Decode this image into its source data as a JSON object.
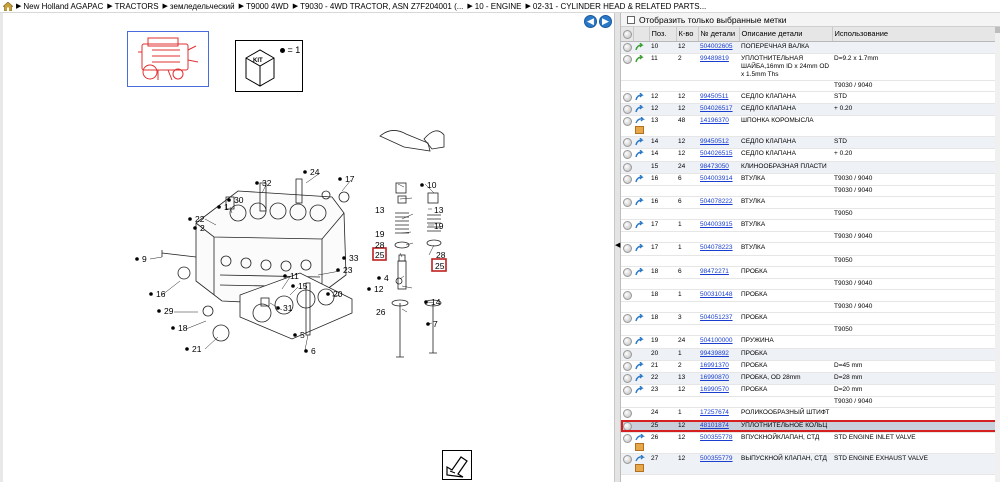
{
  "breadcrumb": [
    "New Holland AGAPAC",
    "TRACTORS",
    "земледельческий",
    "T9000 4WD",
    "T9030 - 4WD TRACTOR, ASN Z7F204001 (...",
    "10 - ENGINE",
    "02-31 - CYLINDER HEAD & RELATED PARTS..."
  ],
  "nav": {
    "back_icon": "arrow-left-icon",
    "forward_icon": "arrow-right-icon"
  },
  "kit": {
    "label": "KIT",
    "equals": "= 1"
  },
  "diagram": {
    "callouts": [
      "24",
      "17",
      "32",
      "30",
      "1",
      "22",
      "2",
      "9",
      "16",
      "29",
      "18",
      "21",
      "23",
      "33",
      "11",
      "15",
      "20",
      "31",
      "5",
      "6",
      "10",
      "13",
      "19",
      "28",
      "25",
      "4",
      "12",
      "26",
      "7",
      "14"
    ],
    "highlighted": [
      "25"
    ]
  },
  "filter": {
    "label": "Отобразить только выбранные метки"
  },
  "table": {
    "headers": [
      "Поз.",
      "К-во",
      "№ детали",
      "Описание детали",
      "Использование"
    ],
    "rows": [
      {
        "pos": "10",
        "qty": "12",
        "pn": "504002605",
        "desc": "ПОПЕРЕЧНАЯ ВАЛКА",
        "use": "",
        "icon": "arrow-green"
      },
      {
        "pos": "11",
        "qty": "2",
        "pn": "99489819",
        "desc": "УПЛОТНИТЕЛЬНАЯ ШАЙБА,16mm ID x 24mm OD x 1.5mm Ths",
        "use": "D=9.2 x 1.7mm",
        "icon": "arrow-green"
      },
      {
        "pos": "",
        "qty": "",
        "pn": "",
        "desc": "",
        "use": "T9030 / 9040",
        "icon": "none",
        "sub": true
      },
      {
        "pos": "12",
        "qty": "12",
        "pn": "99450511",
        "desc": "СЕДЛО КЛАПАНА",
        "use": "STD",
        "icon": "arrow-blue"
      },
      {
        "pos": "12",
        "qty": "12",
        "pn": "504026517",
        "desc": "СЕДЛО КЛАПАНА",
        "use": "+ 0.20",
        "icon": "arrow-blue"
      },
      {
        "pos": "13",
        "qty": "48",
        "pn": "14196370",
        "desc": "ШПОНКА КОРОМЫСЛА",
        "use": "",
        "icon": "box"
      },
      {
        "pos": "14",
        "qty": "12",
        "pn": "99450512",
        "desc": "СЕДЛО КЛАПАНА",
        "use": "STD",
        "icon": "arrow-blue"
      },
      {
        "pos": "14",
        "qty": "12",
        "pn": "504026515",
        "desc": "СЕДЛО КЛАПАНА",
        "use": "+ 0.20",
        "icon": "arrow-blue"
      },
      {
        "pos": "15",
        "qty": "24",
        "pn": "98473050",
        "desc": "КЛИНООБРАЗНАЯ ПЛАСТИ",
        "use": "",
        "icon": "none"
      },
      {
        "pos": "16",
        "qty": "6",
        "pn": "504003914",
        "desc": "ВТУЛКА",
        "use": "T9030 / 9040",
        "icon": "arrow-blue"
      },
      {
        "pos": "",
        "qty": "",
        "pn": "",
        "desc": "",
        "use": "T9030 / 9040",
        "icon": "none",
        "sub": true
      },
      {
        "pos": "16",
        "qty": "6",
        "pn": "504078222",
        "desc": "ВТУЛКА",
        "use": "",
        "icon": "arrow-blue"
      },
      {
        "pos": "",
        "qty": "",
        "pn": "",
        "desc": "",
        "use": "T9050",
        "icon": "none",
        "sub": true
      },
      {
        "pos": "17",
        "qty": "1",
        "pn": "504003915",
        "desc": "ВТУЛКА",
        "use": "",
        "icon": "arrow-blue"
      },
      {
        "pos": "",
        "qty": "",
        "pn": "",
        "desc": "",
        "use": "T9030 / 9040",
        "icon": "none",
        "sub": true
      },
      {
        "pos": "17",
        "qty": "1",
        "pn": "504078223",
        "desc": "ВТУЛКА",
        "use": "",
        "icon": "arrow-blue"
      },
      {
        "pos": "",
        "qty": "",
        "pn": "",
        "desc": "",
        "use": "T9050",
        "icon": "none",
        "sub": true
      },
      {
        "pos": "18",
        "qty": "6",
        "pn": "98472271",
        "desc": "ПРОБКА",
        "use": "",
        "icon": "arrow-blue"
      },
      {
        "pos": "",
        "qty": "",
        "pn": "",
        "desc": "",
        "use": "T9030 / 9040",
        "icon": "none",
        "sub": true
      },
      {
        "pos": "18",
        "qty": "1",
        "pn": "500310148",
        "desc": "ПРОБКА",
        "use": "",
        "icon": "none"
      },
      {
        "pos": "",
        "qty": "",
        "pn": "",
        "desc": "",
        "use": "T9030 / 9040",
        "icon": "none",
        "sub": true
      },
      {
        "pos": "18",
        "qty": "3",
        "pn": "504051237",
        "desc": "ПРОБКА",
        "use": "",
        "icon": "arrow-blue"
      },
      {
        "pos": "",
        "qty": "",
        "pn": "",
        "desc": "",
        "use": "T9050",
        "icon": "none",
        "sub": true
      },
      {
        "pos": "19",
        "qty": "24",
        "pn": "504100000",
        "desc": "ПРУЖИНА",
        "use": "",
        "icon": "arrow-blue"
      },
      {
        "pos": "20",
        "qty": "1",
        "pn": "99439892",
        "desc": "ПРОБКА",
        "use": "",
        "icon": "none"
      },
      {
        "pos": "21",
        "qty": "2",
        "pn": "16991370",
        "desc": "ПРОБКА",
        "use": "D=45 mm",
        "icon": "arrow-blue"
      },
      {
        "pos": "22",
        "qty": "13",
        "pn": "16990870",
        "desc": "ПРОБКА, OD 28mm",
        "use": "D=28 mm",
        "icon": "arrow-blue"
      },
      {
        "pos": "23",
        "qty": "12",
        "pn": "16990570",
        "desc": "ПРОБКА",
        "use": "D=20 mm",
        "icon": "arrow-blue"
      },
      {
        "pos": "",
        "qty": "",
        "pn": "",
        "desc": "",
        "use": "T9030 / 9040",
        "icon": "none",
        "sub": true
      },
      {
        "pos": "24",
        "qty": "1",
        "pn": "17257674",
        "desc": "РОЛИКООБРАЗНЫЙ ШТИФТ",
        "use": "",
        "icon": "none"
      },
      {
        "pos": "25",
        "qty": "12",
        "pn": "48101874",
        "desc": "УПЛОТНИТЕЛЬНОЕ КОЛЬЦ",
        "use": "",
        "icon": "none",
        "selected": true
      },
      {
        "pos": "26",
        "qty": "12",
        "pn": "500355778",
        "desc": "ВПУСКНОЙКЛАПАН, СТД",
        "use": "STD ENGINE INLET VALVE",
        "icon": "box"
      },
      {
        "pos": "27",
        "qty": "12",
        "pn": "500355779",
        "desc": "ВЫПУСКНОЙ КЛАПАН, СТД",
        "use": "STD ENGINE EXHAUST VALVE",
        "icon": "box"
      }
    ]
  },
  "colors": {
    "link": "#1a3fd0",
    "selected_border": "#d42020",
    "accent_blue": "#2a78c8"
  }
}
